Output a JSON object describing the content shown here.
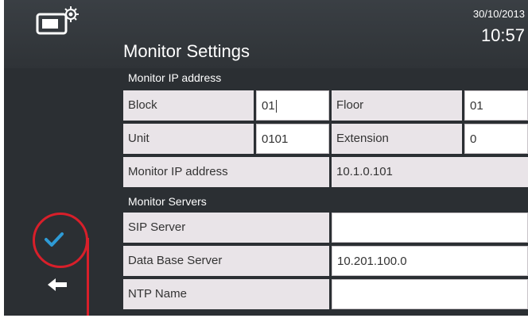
{
  "header": {
    "title": "Monitor Settings",
    "date": "30/10/2013",
    "time": "10:57",
    "icon": "monitor-settings-icon"
  },
  "sections": {
    "ip": {
      "title": "Monitor IP address",
      "block_label": "Block",
      "block_value": "01",
      "floor_label": "Floor",
      "floor_value": "01",
      "unit_label": "Unit",
      "unit_value": "0101",
      "extension_label": "Extension",
      "extension_value": "0",
      "ip_label": "Monitor IP address",
      "ip_value": "10.1.0.101"
    },
    "servers": {
      "title": "Monitor Servers",
      "sip_label": "SIP Server",
      "sip_value": "",
      "db_label": "Data Base Server",
      "db_value": "10.201.100.0",
      "ntp_label": "NTP Name",
      "ntp_value": ""
    }
  },
  "sidebar": {
    "confirm_icon": "checkmark-icon",
    "back_icon": "back-arrow-icon"
  },
  "colors": {
    "accent": "#2e9bd6",
    "highlight": "#d81f2a",
    "background": "#2b2f33",
    "label_bg": "#e9e4e8"
  }
}
